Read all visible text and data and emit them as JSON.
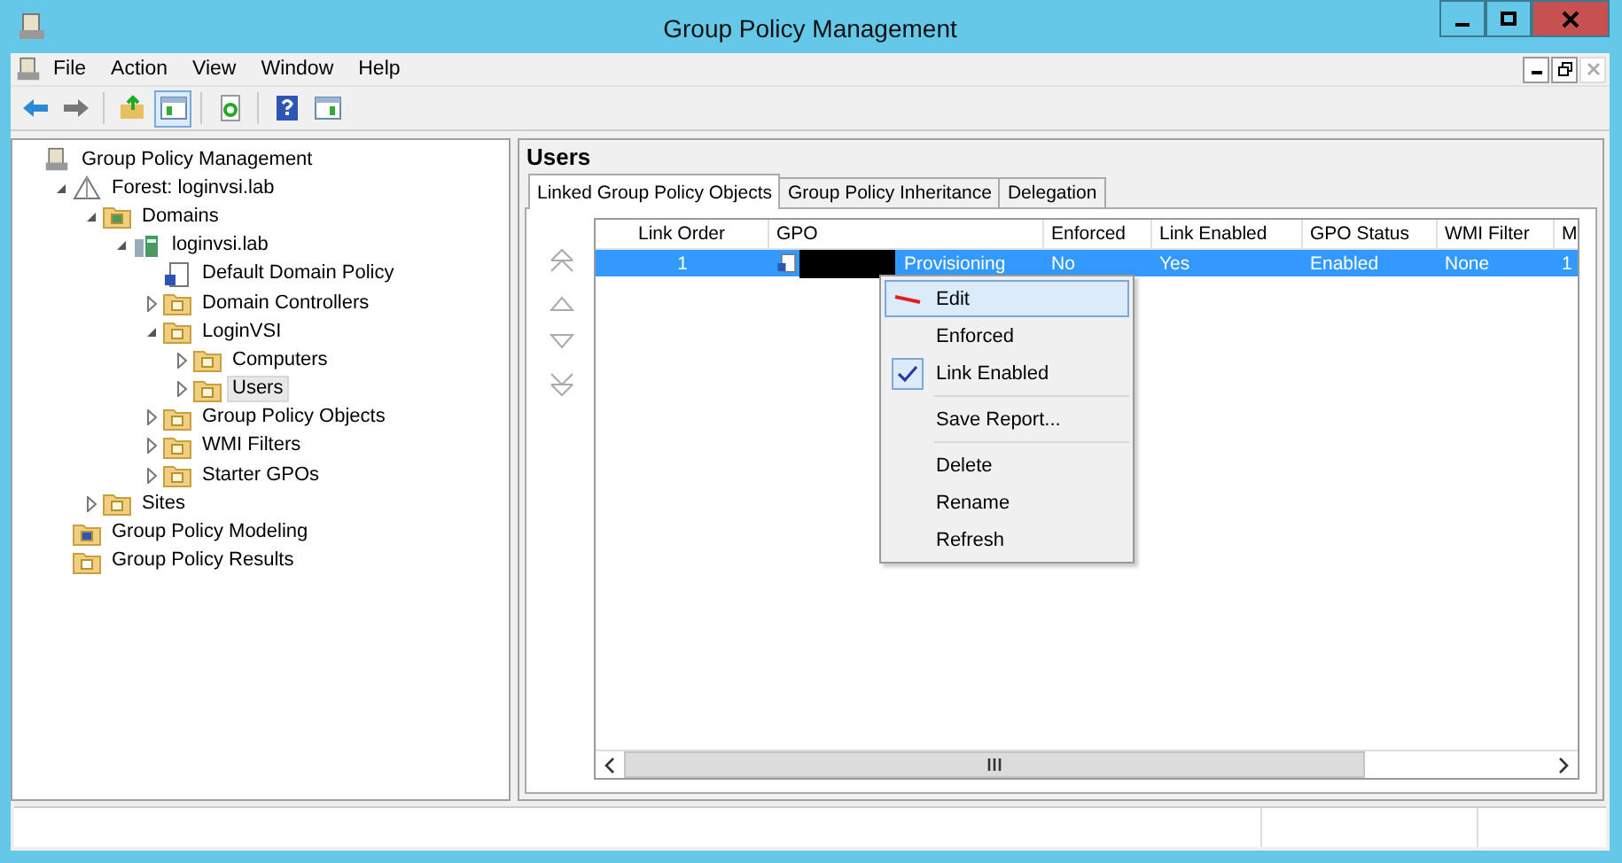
{
  "window": {
    "title": "Group Policy Management"
  },
  "menu": [
    "File",
    "Action",
    "View",
    "Window",
    "Help"
  ],
  "toolbar": [
    {
      "kind": "back",
      "pressed": false
    },
    {
      "kind": "forward",
      "pressed": false
    },
    {
      "kind": "separator"
    },
    {
      "kind": "up",
      "pressed": false
    },
    {
      "kind": "tree",
      "pressed": true
    },
    {
      "kind": "separator"
    },
    {
      "kind": "refresh",
      "pressed": false
    },
    {
      "kind": "separator"
    },
    {
      "kind": "help",
      "pressed": false
    },
    {
      "kind": "pane",
      "pressed": false
    }
  ],
  "tree": [
    {
      "label": "Group Policy Management",
      "kind": "root",
      "selected": false,
      "children": [
        {
          "label": "Forest: loginvsi.lab",
          "kind": "forest",
          "selected": false,
          "expanded": true,
          "children": [
            {
              "label": "Domains",
              "kind": "domains",
              "selected": false,
              "expanded": true,
              "children": [
                {
                  "label": "loginvsi.lab",
                  "kind": "domain",
                  "selected": false,
                  "expanded": true,
                  "children": [
                    {
                      "label": "Default Domain Policy",
                      "kind": "gpo",
                      "selected": false
                    },
                    {
                      "label": "Domain Controllers",
                      "kind": "ou",
                      "selected": false,
                      "expanded": false
                    },
                    {
                      "label": "LoginVSI",
                      "kind": "ou",
                      "selected": false,
                      "expanded": true,
                      "children": [
                        {
                          "label": "Computers",
                          "kind": "ou",
                          "selected": false,
                          "expanded": false
                        },
                        {
                          "label": "Users",
                          "kind": "ou",
                          "selected": true,
                          "expanded": false
                        }
                      ]
                    },
                    {
                      "label": "Group Policy Objects",
                      "kind": "ou",
                      "selected": false,
                      "expanded": false
                    },
                    {
                      "label": "WMI Filters",
                      "kind": "ou",
                      "selected": false,
                      "expanded": false
                    },
                    {
                      "label": "Starter GPOs",
                      "kind": "ou",
                      "selected": false,
                      "expanded": false
                    }
                  ]
                }
              ]
            },
            {
              "label": "Sites",
              "kind": "ou",
              "selected": false,
              "expanded": false
            }
          ]
        },
        {
          "label": "Group Policy Modeling",
          "kind": "modeling",
          "selected": false
        },
        {
          "label": "Group Policy Results",
          "kind": "results",
          "selected": false
        }
      ]
    }
  ],
  "details": {
    "title": "Users",
    "tabs": [
      {
        "label": "Linked Group Policy Objects",
        "selected": true
      },
      {
        "label": "Group Policy Inheritance",
        "selected": false
      },
      {
        "label": "Delegation",
        "selected": false
      }
    ],
    "columns": [
      "Link Order",
      "GPO",
      "Enforced",
      "Link Enabled",
      "GPO Status",
      "WMI Filter",
      "M"
    ],
    "rows": [
      {
        "selected": true,
        "cells": [
          "1",
          "Provisioning",
          "No",
          "Yes",
          "Enabled",
          "None",
          "1"
        ]
      }
    ]
  },
  "context_menu": [
    {
      "kind": "icon-item",
      "label": "Edit",
      "selected": true,
      "checked": false
    },
    {
      "kind": "item",
      "label": "Enforced",
      "selected": false,
      "checked": false
    },
    {
      "kind": "item",
      "label": "Link Enabled",
      "selected": false,
      "checked": true
    },
    {
      "kind": "separator"
    },
    {
      "kind": "item",
      "label": "Save Report...",
      "selected": false,
      "checked": false
    },
    {
      "kind": "separator"
    },
    {
      "kind": "item",
      "label": "Delete",
      "selected": false,
      "checked": false
    },
    {
      "kind": "item",
      "label": "Rename",
      "selected": false,
      "checked": false
    },
    {
      "kind": "item",
      "label": "Refresh",
      "selected": false,
      "checked": false
    }
  ]
}
